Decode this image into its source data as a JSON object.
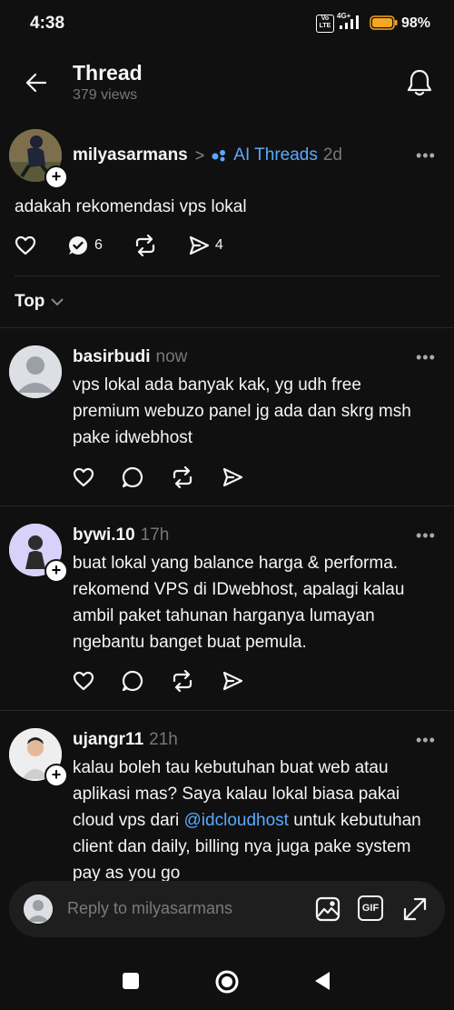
{
  "status_bar": {
    "time": "4:38",
    "network": "4G+",
    "volte": "Vo LTE",
    "battery": "98%"
  },
  "header": {
    "title": "Thread",
    "views": "379 views"
  },
  "post": {
    "username": "milyasarmans",
    "separator": ">",
    "community": "AI Threads",
    "time": "2d",
    "text": "adakah rekomendasi vps lokal",
    "replies_count": "6",
    "shares_count": "4"
  },
  "sort": {
    "label": "Top"
  },
  "replies": [
    {
      "username": "basirbudi",
      "time": "now",
      "lines": [
        "vps lokal ada banyak kak, yg udh free",
        "premium webuzo panel jg ada dan skrg msh",
        "pake idwebhost"
      ]
    },
    {
      "username": "bywi.10",
      "time": "17h",
      "lines": [
        "buat lokal yang balance harga & performa.",
        "rekomend VPS di IDwebhost, apalagi kalau",
        "ambil paket tahunan harganya lumayan",
        "ngebantu banget buat pemula."
      ]
    },
    {
      "username": "ujangr11",
      "time": "21h",
      "lines": [
        "kalau boleh tau kebutuhan buat web atau",
        "aplikasi mas? Saya kalau lokal biasa pakai"
      ],
      "line3_prefix": "cloud vps dari ",
      "mention": "@idcloudhost",
      "line3_suffix": " untuk kebutuhan",
      "lines_after": [
        "client dan daily, billing nya juga pake system",
        "pay as you go"
      ]
    }
  ],
  "composer": {
    "placeholder": "Reply to milyasarmans",
    "gif_label": "GIF"
  },
  "colors": {
    "background": "#101010",
    "text": "#f3f5f7",
    "muted": "#777777",
    "link": "#5aa9ff",
    "community_dot": "#5aa9ff"
  },
  "icons": [
    "back-arrow-icon",
    "bell-icon",
    "heart-icon",
    "reply-check-icon",
    "repost-icon",
    "share-icon",
    "comment-icon",
    "image-icon",
    "gif-icon",
    "expand-icon",
    "home-square-icon",
    "home-circle-icon",
    "back-triangle-icon"
  ]
}
